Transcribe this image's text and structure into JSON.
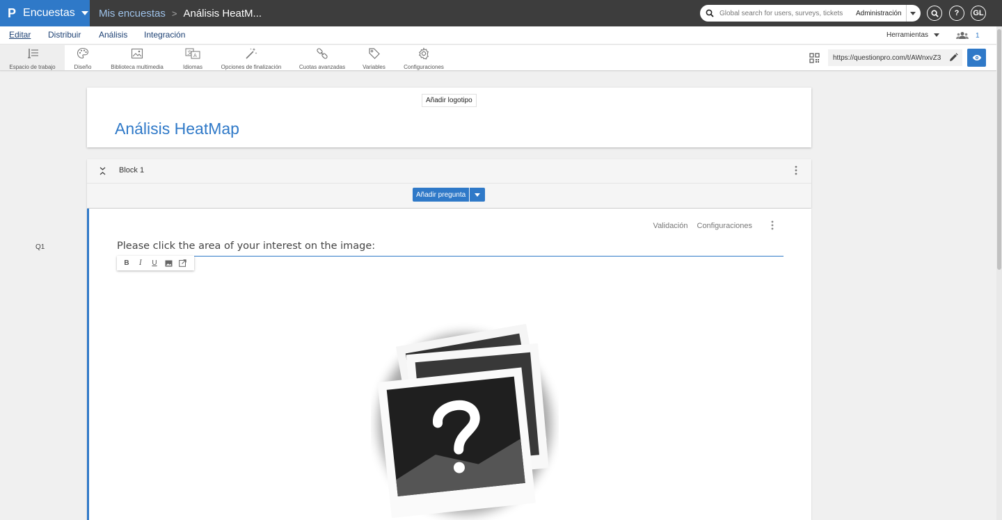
{
  "topbar": {
    "brand": "Encuestas",
    "breadcrumb_root": "Mis encuestas",
    "breadcrumb_current": "Análisis HeatM...",
    "search_placeholder": "Global search for users, surveys, tickets",
    "admin_label": "Administración",
    "help_label": "?",
    "user_initials": "GL"
  },
  "nav": {
    "tabs": [
      {
        "label": "Editar"
      },
      {
        "label": "Distribuir"
      },
      {
        "label": "Análisis"
      },
      {
        "label": "Integración"
      }
    ],
    "tools_label": "Herramientas",
    "collaborators_count": "1"
  },
  "toolbar": {
    "items": [
      {
        "label": "Espacio de trabajo"
      },
      {
        "label": "Diseño"
      },
      {
        "label": "Biblioteca multimedia"
      },
      {
        "label": "Idiomas"
      },
      {
        "label": "Opciones de finalización"
      },
      {
        "label": "Cuotas avanzadas"
      },
      {
        "label": "Variables"
      },
      {
        "label": "Configuraciones"
      }
    ],
    "survey_url": "https://questionpro.com/t/AWnxvZ3"
  },
  "survey": {
    "add_logo": "Añadir logotipo",
    "title": "Análisis HeatMap"
  },
  "block": {
    "name": "Block 1",
    "add_question": "Añadir pregunta"
  },
  "question": {
    "number": "Q1",
    "validation": "Validación",
    "settings": "Configuraciones",
    "text": "Please click the area of your interest on the image:"
  },
  "colors": {
    "brand_blue": "#2f79c8",
    "topbar_bg": "#3d3d3d",
    "nav_link": "#1b3f72"
  }
}
